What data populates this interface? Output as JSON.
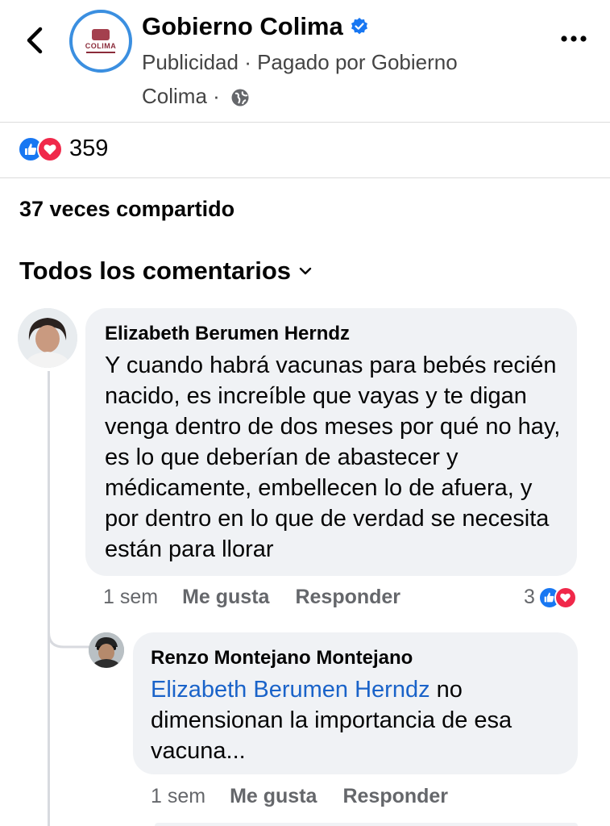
{
  "header": {
    "page_name": "Gobierno Colima",
    "logo_text": "COLIMA",
    "ad_line": "Publicidad · Pagado por Gobierno Colima ·"
  },
  "reactions": {
    "count": "359"
  },
  "shares": "37 veces compartido",
  "comments_header": "Todos los comentarios",
  "comments": [
    {
      "author": "Elizabeth Berumen Herndz",
      "text": "Y cuando habrá vacunas para bebés recién nacido, es increíble que vayas y te digan venga dentro de dos meses por qué no hay, es lo que deberían de abastecer y médicamente, embellecen lo de afuera, y por dentro en lo que de verdad se necesita están para llorar",
      "time": "1 sem",
      "like_label": "Me gusta",
      "reply_label": "Responder",
      "reaction_count": "3"
    },
    {
      "author": "Renzo Montejano Montejano",
      "mention": "Elizabeth Berumen Herndz",
      "text": " no dimensionan la importancia de esa vacuna...",
      "time": "1 sem",
      "like_label": "Me gusta",
      "reply_label": "Responder"
    }
  ],
  "colors": {
    "accent": "#1877f2",
    "love": "#f0284a",
    "bubble": "#f0f2f5",
    "mention": "#1a63c9"
  }
}
